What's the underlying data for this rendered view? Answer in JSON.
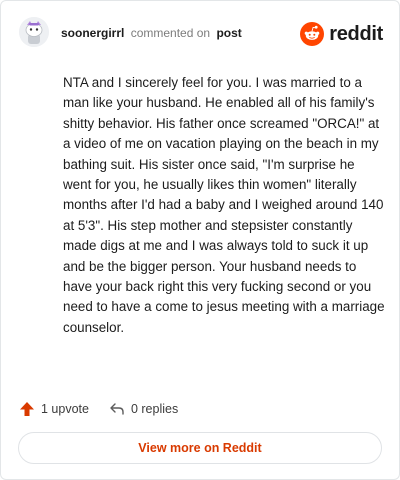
{
  "header": {
    "username": "soonergirrl",
    "action_text": "commented on",
    "post_link": "post",
    "logo_text": "reddit"
  },
  "comment": {
    "body": "NTA and I sincerely feel for you. I was married to a man like your husband. He enabled all of his family's shitty behavior. His father once screamed \"ORCA!\" at a video of me on vacation playing on the beach in my bathing suit. His sister once said, \"I'm surprise he went for you, he usually likes thin women\" literally months after I'd had a baby and I weighed around 140 at 5'3\". His step mother and stepsister constantly made digs at me and I was always told to suck it up and be the bigger person. Your husband needs to have your back right this very fucking second or you need to have a come to jesus meeting with a marriage counselor."
  },
  "actions": {
    "upvotes_label": "1 upvote",
    "replies_label": "0 replies"
  },
  "footer": {
    "view_more_label": "View more on Reddit"
  },
  "colors": {
    "brand": "#ff4500",
    "link": "#d93a00"
  }
}
